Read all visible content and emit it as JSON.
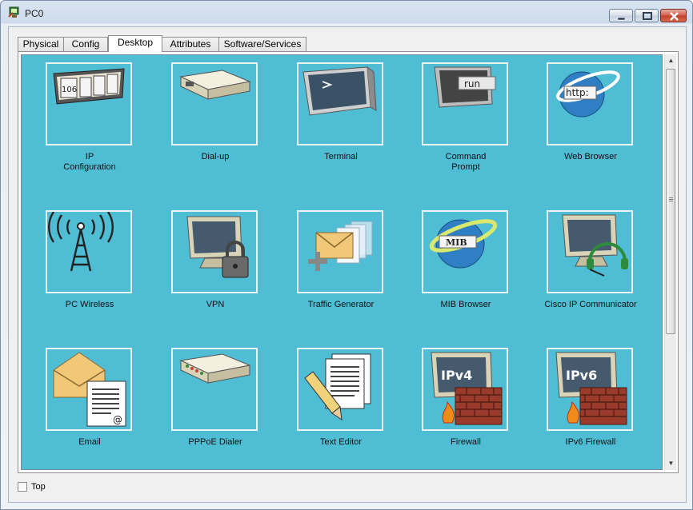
{
  "window": {
    "title": "PC0",
    "controls": {
      "minimize": "minimize-icon",
      "maximize": "maximize-icon",
      "close": "close-icon"
    }
  },
  "tabs": [
    {
      "label": "Physical",
      "active": false
    },
    {
      "label": "Config",
      "active": false
    },
    {
      "label": "Desktop",
      "active": true
    },
    {
      "label": "Attributes",
      "active": false
    },
    {
      "label": "Software/Services",
      "active": false
    }
  ],
  "desktop": {
    "background": "#4fbdd4",
    "apps": [
      {
        "label": "IP\nConfiguration",
        "icon": "ip-configuration-icon"
      },
      {
        "label": "Dial-up",
        "icon": "dial-up-modem-icon"
      },
      {
        "label": "Terminal",
        "icon": "terminal-icon"
      },
      {
        "label": "Command\nPrompt",
        "icon": "command-prompt-icon",
        "icon_text": "run"
      },
      {
        "label": "Web Browser",
        "icon": "web-browser-icon",
        "icon_text": "http:"
      },
      {
        "label": "PC Wireless",
        "icon": "wireless-tower-icon"
      },
      {
        "label": "VPN",
        "icon": "vpn-lock-icon"
      },
      {
        "label": "Traffic Generator",
        "icon": "traffic-generator-icon"
      },
      {
        "label": "MIB Browser",
        "icon": "mib-browser-icon",
        "icon_text": "MIB"
      },
      {
        "label": "Cisco IP Communicator",
        "icon": "ip-communicator-icon"
      },
      {
        "label": "Email",
        "icon": "email-icon",
        "icon_text": "@"
      },
      {
        "label": "PPPoE Dialer",
        "icon": "pppoe-dialer-icon"
      },
      {
        "label": "Text Editor",
        "icon": "text-editor-icon"
      },
      {
        "label": "Firewall",
        "icon": "firewall-icon",
        "icon_text": "IPv4"
      },
      {
        "label": "IPv6 Firewall",
        "icon": "ipv6-firewall-icon",
        "icon_text": "IPv6"
      }
    ],
    "ip_config_digits": "106"
  },
  "footer": {
    "top_checkbox_label": "Top",
    "top_checked": false
  }
}
